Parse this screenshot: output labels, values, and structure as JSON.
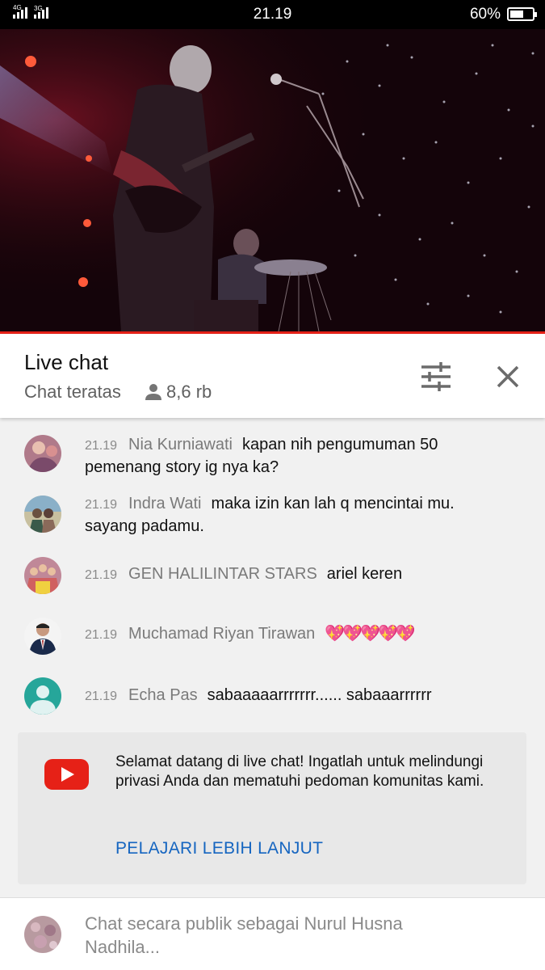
{
  "status_bar": {
    "time": "21.19",
    "battery_percent": "60%",
    "battery_level": 0.6,
    "net1": "4G",
    "net2": "3G"
  },
  "video": {
    "progress": 1.0,
    "accent_color": "#e62117"
  },
  "chat_header": {
    "title": "Live chat",
    "mode": "Chat teratas",
    "viewer_count": "8,6 rb",
    "viewer_icon": "person-icon",
    "filter_icon": "tune-icon",
    "close_icon": "close-icon"
  },
  "messages": [
    {
      "time": "21.19",
      "author": "Nia Kurniawati",
      "text": "kapan nih pengumuman 50 pemenang story ig nya ka?"
    },
    {
      "time": "21.19",
      "author": "Indra Wati",
      "text": "maka izin kan lah q mencintai mu. sayang padamu."
    },
    {
      "time": "21.19",
      "author": "GEN HALILINTAR STARS",
      "text": "ariel keren"
    },
    {
      "time": "21.19",
      "author": "Muchamad Riyan Tirawan",
      "text": "💖💖💖💖💖"
    },
    {
      "time": "21.19",
      "author": "Echa Pas",
      "text": "sabaaaaarrrrrrr...... sabaaarrrrrr"
    }
  ],
  "welcome": {
    "text": "Selamat datang di live chat! Ingatlah untuk melindungi privasi Anda dan mematuhi pedoman komunitas kami.",
    "link": "PELAJARI LEBIH LANJUT",
    "logo_icon": "youtube-logo-icon"
  },
  "input": {
    "placeholder": "Chat secara publik sebagai Nurul Husna Nadhila..."
  }
}
